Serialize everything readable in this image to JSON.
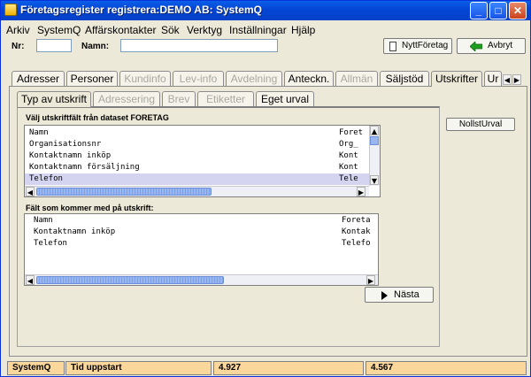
{
  "window": {
    "title": "Företagsregister registrera:DEMO AB: SystemQ",
    "minimize": "_",
    "maximize": "□",
    "close": "✕"
  },
  "menu": {
    "arkiv": "Arkiv",
    "systemq": "SystemQ",
    "affarskontakter": "Affärskontakter",
    "sok": "Sök",
    "verktyg": "Verktyg",
    "installningar": "Inställningar",
    "hjalp": "Hjälp"
  },
  "form": {
    "nr_label": "Nr:",
    "nr_value": "",
    "namn_label": "Namn:",
    "namn_value": "",
    "new_button": "NyttFöretag",
    "cancel_button": "Avbryt"
  },
  "main_tabs": [
    {
      "label": "Adresser",
      "state": "enabled"
    },
    {
      "label": "Personer",
      "state": "enabled"
    },
    {
      "label": "Kundinfo",
      "state": "disabled"
    },
    {
      "label": "Lev-info",
      "state": "disabled"
    },
    {
      "label": "Avdelning",
      "state": "disabled"
    },
    {
      "label": "Anteckn.",
      "state": "enabled"
    },
    {
      "label": "Allmän",
      "state": "disabled"
    },
    {
      "label": "Säljstöd",
      "state": "enabled"
    },
    {
      "label": "Utskrifter",
      "state": "selected"
    },
    {
      "label": "Ur",
      "state": "enabled"
    }
  ],
  "sub_tabs": [
    {
      "label": "Typ av utskrift",
      "state": "selected"
    },
    {
      "label": "Adressering",
      "state": "disabled"
    },
    {
      "label": "Brev",
      "state": "disabled"
    },
    {
      "label": "Etiketter",
      "state": "disabled"
    },
    {
      "label": "Eget urval",
      "state": "enabled"
    }
  ],
  "available_fields": {
    "heading": "Välj utskriftfält från dataset FORETAG",
    "rows": [
      {
        "name": "Namn",
        "field": "Foret"
      },
      {
        "name": "Organisationsnr",
        "field": "Org_"
      },
      {
        "name": "Kontaktnamn inköp",
        "field": "Kont"
      },
      {
        "name": "Kontaktnamn försäljning",
        "field": "Kont"
      },
      {
        "name": "Telefon",
        "field": "Tele",
        "selected": true
      }
    ]
  },
  "selected_fields": {
    "heading": "Fält som kommer med på utskrift:",
    "rows": [
      {
        "name": "Namn",
        "field": "Foreta"
      },
      {
        "name": "Kontaktnamn inköp",
        "field": "Kontak"
      },
      {
        "name": "Telefon",
        "field": "Telefo"
      }
    ]
  },
  "buttons": {
    "nollst": "NollstUrval",
    "nasta": "Nästa"
  },
  "status": {
    "app": "SystemQ",
    "startup_label": "Tid uppstart",
    "value1": "4.927",
    "value2": "4.567"
  },
  "icons": {
    "window": "app-icon",
    "new": "document-icon",
    "cancel": "arrow-left-icon",
    "next": "play-right-icon"
  },
  "colors": {
    "titlebar": "#0546d6",
    "status_cell": "#fcd79c",
    "cancel_arrow": "#1e9e1e",
    "selected_row": "#d4d4f0"
  }
}
